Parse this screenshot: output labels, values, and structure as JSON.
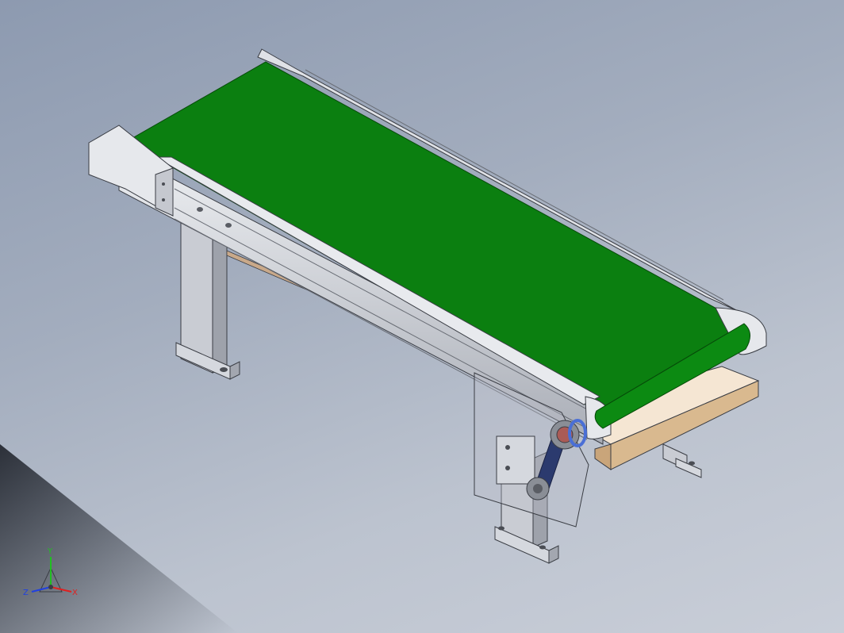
{
  "viewport": {
    "background_top": "#8d9ab0",
    "background_bottom": "#c9ced8"
  },
  "model": {
    "belt_color": "#0b7f10",
    "frame_color": "#d4d6dc",
    "tray_color": "#f5e6d3",
    "guard_color": "#b9bec8",
    "drive_belt_color": "#2b3a6e",
    "pulley_accent_color": "#4a6fd6"
  },
  "triad": {
    "x_label": "X",
    "y_label": "Y",
    "z_label": "Z",
    "x_color": "#e02020",
    "y_color": "#20c020",
    "z_color": "#2040e0"
  }
}
